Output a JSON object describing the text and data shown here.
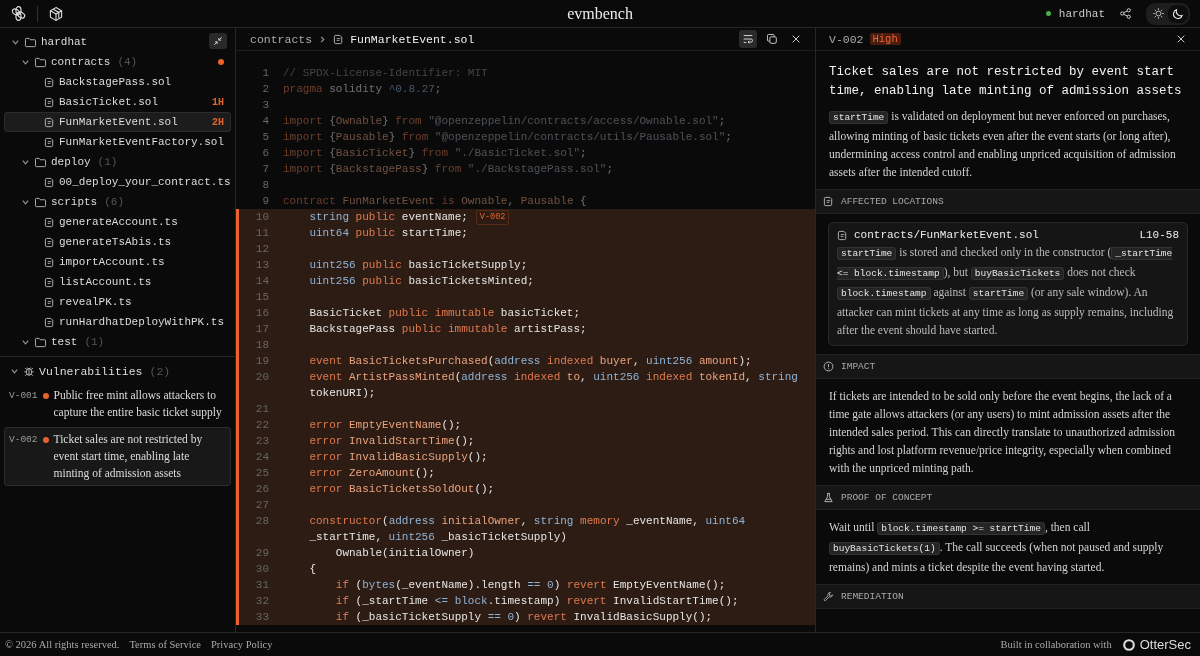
{
  "header": {
    "title": "evmbench",
    "project": "hardhat",
    "theme": [
      {
        "kind": "light",
        "selected": false
      },
      {
        "kind": "dark",
        "selected": true
      }
    ]
  },
  "explorer": {
    "tree": [
      {
        "name": "hardhat",
        "kind": "folder",
        "expanded": true,
        "selected": false,
        "flagged": false,
        "children": [
          {
            "name": "contracts",
            "count": "(4)",
            "kind": "folder",
            "expanded": true,
            "selected": false,
            "flagged": true,
            "children": [
              {
                "name": "BackstagePass.sol",
                "kind": "file",
                "selected": false,
                "flagged": false
              },
              {
                "name": "BasicTicket.sol",
                "kind": "file",
                "badge": "1H",
                "selected": false,
                "flagged": false
              },
              {
                "name": "FunMarketEvent.sol",
                "kind": "file",
                "badge": "2H",
                "selected": true,
                "flagged": false
              },
              {
                "name": "FunMarketEventFactory.sol",
                "kind": "file",
                "selected": false,
                "flagged": false
              }
            ]
          },
          {
            "name": "deploy",
            "count": "(1)",
            "kind": "folder",
            "expanded": true,
            "selected": false,
            "flagged": false,
            "children": [
              {
                "name": "00_deploy_your_contract.ts",
                "kind": "file",
                "selected": false,
                "flagged": false
              }
            ]
          },
          {
            "name": "scripts",
            "count": "(6)",
            "kind": "folder",
            "expanded": true,
            "selected": false,
            "flagged": false,
            "children": [
              {
                "name": "generateAccount.ts",
                "kind": "file",
                "selected": false,
                "flagged": false
              },
              {
                "name": "generateTsAbis.ts",
                "kind": "file",
                "selected": false,
                "flagged": false
              },
              {
                "name": "importAccount.ts",
                "kind": "file",
                "selected": false,
                "flagged": false
              },
              {
                "name": "listAccount.ts",
                "kind": "file",
                "selected": false,
                "flagged": false
              },
              {
                "name": "revealPK.ts",
                "kind": "file",
                "selected": false,
                "flagged": false
              },
              {
                "name": "runHardhatDeployWithPK.ts",
                "kind": "file",
                "selected": false,
                "flagged": false
              }
            ]
          },
          {
            "name": "test",
            "count": "(1)",
            "kind": "folder",
            "expanded": true,
            "selected": false,
            "flagged": false
          }
        ]
      }
    ]
  },
  "vulnerabilities": {
    "title": "Vulnerabilities",
    "count": "(2)",
    "expanded": true,
    "items": [
      {
        "id": "V-001",
        "text": "Public free mint allows attackers to capture the entire basic ticket supply",
        "selected": false
      },
      {
        "id": "V-002",
        "text": "Ticket sales are not restricted by event start time, enabling late minting of admission assets",
        "selected": true
      }
    ]
  },
  "editor": {
    "breadcrumb": [
      "contracts",
      "FunMarketEvent.sol"
    ],
    "wrap": true,
    "lines": [
      {
        "number": "1",
        "highlighted": false,
        "tokens": [
          {
            "kind": "comment",
            "text": "// SPDX-License-Identifier: MIT"
          }
        ]
      },
      {
        "number": "2",
        "highlighted": false,
        "tokens": [
          {
            "kind": "keyword",
            "text": "pragma"
          },
          {
            "kind": "plain",
            "text": " solidity "
          },
          {
            "kind": "type",
            "text": "^0.8.27"
          },
          {
            "kind": "plain",
            "text": ";"
          }
        ]
      },
      {
        "number": "3",
        "highlighted": false
      },
      {
        "number": "4",
        "highlighted": false,
        "tokens": [
          {
            "kind": "keyword",
            "text": "import"
          },
          {
            "kind": "plain",
            "text": " {"
          },
          {
            "kind": "name",
            "text": "Ownable"
          },
          {
            "kind": "plain",
            "text": "} "
          },
          {
            "kind": "keyword",
            "text": "from"
          },
          {
            "kind": "string",
            "text": " \"@openzeppelin/contracts/access/Ownable.sol\""
          },
          {
            "kind": "plain",
            "text": ";"
          }
        ]
      },
      {
        "number": "5",
        "highlighted": false,
        "tokens": [
          {
            "kind": "keyword",
            "text": "import"
          },
          {
            "kind": "plain",
            "text": " {"
          },
          {
            "kind": "name",
            "text": "Pausable"
          },
          {
            "kind": "plain",
            "text": "} "
          },
          {
            "kind": "keyword",
            "text": "from"
          },
          {
            "kind": "string",
            "text": " \"@openzeppelin/contracts/utils/Pausable.sol\""
          },
          {
            "kind": "plain",
            "text": ";"
          }
        ]
      },
      {
        "number": "6",
        "highlighted": false,
        "tokens": [
          {
            "kind": "keyword",
            "text": "import"
          },
          {
            "kind": "plain",
            "text": " {"
          },
          {
            "kind": "name",
            "text": "BasicTicket"
          },
          {
            "kind": "plain",
            "text": "} "
          },
          {
            "kind": "keyword",
            "text": "from"
          },
          {
            "kind": "string",
            "text": " \"./BasicTicket.sol\""
          },
          {
            "kind": "plain",
            "text": ";"
          }
        ]
      },
      {
        "number": "7",
        "highlighted": false,
        "tokens": [
          {
            "kind": "keyword",
            "text": "import"
          },
          {
            "kind": "plain",
            "text": " {"
          },
          {
            "kind": "name",
            "text": "BackstagePass"
          },
          {
            "kind": "plain",
            "text": "} "
          },
          {
            "kind": "keyword",
            "text": "from"
          },
          {
            "kind": "string",
            "text": " \"./BackstagePass.sol\""
          },
          {
            "kind": "plain",
            "text": ";"
          }
        ]
      },
      {
        "number": "8",
        "highlighted": false
      },
      {
        "number": "9",
        "highlighted": false,
        "tokens": [
          {
            "kind": "keyword",
            "text": "contract "
          },
          {
            "kind": "name",
            "text": "FunMarketEvent "
          },
          {
            "kind": "keyword",
            "text": "is "
          },
          {
            "kind": "name",
            "text": "Ownable"
          },
          {
            "kind": "plain",
            "text": ", "
          },
          {
            "kind": "name",
            "text": "Pausable"
          },
          {
            "kind": "plain",
            "text": " {"
          }
        ],
        "children": [
          {
            "number": "10",
            "highlighted": true,
            "badge": "V-002",
            "tokens": [
              {
                "kind": "type",
                "text": "string "
              },
              {
                "kind": "keyword",
                "text": "public "
              },
              {
                "kind": "plain",
                "text": "eventName;"
              }
            ]
          },
          {
            "number": "11",
            "highlighted": true,
            "tokens": [
              {
                "kind": "type",
                "text": "uint64 "
              },
              {
                "kind": "keyword",
                "text": "public "
              },
              {
                "kind": "plain",
                "text": "startTime;"
              }
            ]
          },
          {
            "number": "12",
            "highlighted": true
          },
          {
            "number": "13",
            "highlighted": true,
            "tokens": [
              {
                "kind": "type",
                "text": "uint256 "
              },
              {
                "kind": "keyword",
                "text": "public "
              },
              {
                "kind": "plain",
                "text": "basicTicketSupply;"
              }
            ]
          },
          {
            "number": "14",
            "highlighted": true,
            "tokens": [
              {
                "kind": "type",
                "text": "uint256 "
              },
              {
                "kind": "keyword",
                "text": "public "
              },
              {
                "kind": "plain",
                "text": "basicTicketsMinted;"
              }
            ]
          },
          {
            "number": "15",
            "highlighted": true
          },
          {
            "number": "16",
            "highlighted": true,
            "tokens": [
              {
                "kind": "plain",
                "text": "BasicTicket "
              },
              {
                "kind": "keyword",
                "text": "public immutable "
              },
              {
                "kind": "plain",
                "text": "basicTicket;"
              }
            ]
          },
          {
            "number": "17",
            "highlighted": true,
            "tokens": [
              {
                "kind": "plain",
                "text": "BackstagePass "
              },
              {
                "kind": "keyword",
                "text": "public immutable "
              },
              {
                "kind": "plain",
                "text": "artistPass;"
              }
            ]
          },
          {
            "number": "18",
            "highlighted": true
          },
          {
            "number": "19",
            "highlighted": true,
            "tokens": [
              {
                "kind": "keyword",
                "text": "event "
              },
              {
                "kind": "name",
                "text": "BasicTicketsPurchased"
              },
              {
                "kind": "plain",
                "text": "("
              },
              {
                "kind": "type",
                "text": "address "
              },
              {
                "kind": "keyword",
                "text": "indexed "
              },
              {
                "kind": "name",
                "text": "buyer"
              },
              {
                "kind": "plain",
                "text": ", "
              },
              {
                "kind": "type",
                "text": "uint256 "
              },
              {
                "kind": "name",
                "text": "amount"
              },
              {
                "kind": "plain",
                "text": ");"
              }
            ]
          },
          {
            "number": "20",
            "highlighted": true,
            "tokens": [
              {
                "kind": "keyword",
                "text": "event "
              },
              {
                "kind": "name",
                "text": "ArtistPassMinted"
              },
              {
                "kind": "plain",
                "text": "("
              },
              {
                "kind": "type",
                "text": "address "
              },
              {
                "kind": "keyword",
                "text": "indexed "
              },
              {
                "kind": "name",
                "text": "to"
              },
              {
                "kind": "plain",
                "text": ", "
              },
              {
                "kind": "type",
                "text": "uint256 "
              },
              {
                "kind": "keyword",
                "text": "indexed "
              },
              {
                "kind": "name",
                "text": "tokenId"
              },
              {
                "kind": "plain",
                "text": ", "
              },
              {
                "kind": "type",
                "text": "string "
              },
              {
                "kind": "plain",
                "text": "tokenURI);"
              }
            ]
          },
          {
            "number": "21",
            "highlighted": true
          },
          {
            "number": "22",
            "highlighted": true,
            "tokens": [
              {
                "kind": "keyword",
                "text": "error "
              },
              {
                "kind": "name",
                "text": "EmptyEventName"
              },
              {
                "kind": "plain",
                "text": "();"
              }
            ]
          },
          {
            "number": "23",
            "highlighted": true,
            "tokens": [
              {
                "kind": "keyword",
                "text": "error "
              },
              {
                "kind": "name",
                "text": "InvalidStartTime"
              },
              {
                "kind": "plain",
                "text": "();"
              }
            ]
          },
          {
            "number": "24",
            "highlighted": true,
            "tokens": [
              {
                "kind": "keyword",
                "text": "error "
              },
              {
                "kind": "name",
                "text": "InvalidBasicSupply"
              },
              {
                "kind": "plain",
                "text": "();"
              }
            ]
          },
          {
            "number": "25",
            "highlighted": true,
            "tokens": [
              {
                "kind": "keyword",
                "text": "error "
              },
              {
                "kind": "name",
                "text": "ZeroAmount"
              },
              {
                "kind": "plain",
                "text": "();"
              }
            ]
          },
          {
            "number": "26",
            "highlighted": true,
            "tokens": [
              {
                "kind": "keyword",
                "text": "error "
              },
              {
                "kind": "name",
                "text": "BasicTicketsSoldOut"
              },
              {
                "kind": "plain",
                "text": "();"
              }
            ]
          },
          {
            "number": "27",
            "highlighted": true
          },
          {
            "number": "28",
            "highlighted": true,
            "tokens": [
              {
                "kind": "keyword",
                "text": "constructor"
              },
              {
                "kind": "plain",
                "text": "("
              },
              {
                "kind": "type",
                "text": "address "
              },
              {
                "kind": "name",
                "text": "initialOwner"
              },
              {
                "kind": "plain",
                "text": ", "
              },
              {
                "kind": "type",
                "text": "string "
              },
              {
                "kind": "keyword",
                "text": "memory "
              },
              {
                "kind": "plain",
                "text": "_eventName, "
              },
              {
                "kind": "type",
                "text": "uint64 "
              },
              {
                "kind": "plain",
                "text": "_startTime, "
              },
              {
                "kind": "type",
                "text": "uint256 "
              },
              {
                "kind": "plain",
                "text": "_basicTicketSupply)"
              }
            ],
            "children": [
              {
                "number": "29",
                "highlighted": true,
                "tokens": [
                  {
                    "kind": "plain",
                    "text": "Ownable(initialOwner)"
                  }
                ]
              }
            ]
          },
          {
            "number": "30",
            "highlighted": true,
            "tokens": [
              {
                "kind": "plain",
                "text": "{"
              }
            ],
            "children": [
              {
                "number": "31",
                "highlighted": true,
                "tokens": [
                  {
                    "kind": "keyword",
                    "text": "if "
                  },
                  {
                    "kind": "plain",
                    "text": "("
                  },
                  {
                    "kind": "type",
                    "text": "bytes"
                  },
                  {
                    "kind": "plain",
                    "text": "(_eventName).length "
                  },
                  {
                    "kind": "type",
                    "text": "== 0"
                  },
                  {
                    "kind": "plain",
                    "text": ") "
                  },
                  {
                    "kind": "keyword",
                    "text": "revert "
                  },
                  {
                    "kind": "plain",
                    "text": "EmptyEventName();"
                  }
                ]
              },
              {
                "number": "32",
                "highlighted": true,
                "tokens": [
                  {
                    "kind": "keyword",
                    "text": "if "
                  },
                  {
                    "kind": "plain",
                    "text": "(_startTime "
                  },
                  {
                    "kind": "type",
                    "text": "<= block"
                  },
                  {
                    "kind": "plain",
                    "text": ".timestamp) "
                  },
                  {
                    "kind": "keyword",
                    "text": "revert "
                  },
                  {
                    "kind": "plain",
                    "text": "InvalidStartTime();"
                  }
                ]
              },
              {
                "number": "33",
                "highlighted": true,
                "tokens": [
                  {
                    "kind": "keyword",
                    "text": "if "
                  },
                  {
                    "kind": "plain",
                    "text": "(_basicTicketSupply "
                  },
                  {
                    "kind": "type",
                    "text": "== 0"
                  },
                  {
                    "kind": "plain",
                    "text": ") "
                  },
                  {
                    "kind": "keyword",
                    "text": "revert "
                  },
                  {
                    "kind": "plain",
                    "text": "InvalidBasicSupply();"
                  }
                ]
              }
            ]
          }
        ]
      }
    ]
  },
  "finding": {
    "id": "V-002",
    "severity": "High",
    "title": "Ticket sales are not restricted by event start time, enabling late minting of admission assets",
    "summary": [
      {
        "kind": "code",
        "text": "startTime"
      },
      {
        "kind": "text",
        "text": " is validated on deployment but never enforced on purchases, allowing minting of basic tickets even after the event starts (or long after), undermining access control and enabling unpriced acquisition of admission assets after the intended cutoff."
      }
    ],
    "sections": [
      {
        "kind": "locations",
        "heading": "AFFECTED LOCATIONS",
        "locations": [
          {
            "file": "contracts/FunMarketEvent.sol",
            "range": "L10-58",
            "note": [
              {
                "kind": "code",
                "text": "startTime"
              },
              {
                "kind": "text",
                "text": " is stored and checked only in the constructor ("
              },
              {
                "kind": "code",
                "text": "_startTime <= block.timestamp"
              },
              {
                "kind": "text",
                "text": "), but "
              },
              {
                "kind": "code",
                "text": "buyBasicTickets"
              },
              {
                "kind": "text",
                "text": " does not check "
              },
              {
                "kind": "code",
                "text": "block.timestamp"
              },
              {
                "kind": "text",
                "text": " against "
              },
              {
                "kind": "code",
                "text": "startTime"
              },
              {
                "kind": "text",
                "text": " (or any sale window). An attacker can mint tickets at any time as long as supply remains, including after the event should have started."
              }
            ]
          }
        ]
      },
      {
        "kind": "impact",
        "heading": "IMPACT",
        "body": [
          {
            "kind": "text",
            "text": "If tickets are intended to be sold only before the event begins, the lack of a time gate allows attackers (or any users) to mint admission assets after the intended sales period. This can directly translate to unauthorized admission rights and lost platform revenue/price integrity, especially when combined with the unpriced minting path."
          }
        ]
      },
      {
        "kind": "poc",
        "heading": "PROOF OF CONCEPT",
        "body": [
          {
            "kind": "text",
            "text": "Wait until "
          },
          {
            "kind": "code",
            "text": "block.timestamp >= startTime"
          },
          {
            "kind": "text",
            "text": ", then call "
          },
          {
            "kind": "code",
            "text": "buyBasicTickets(1)"
          },
          {
            "kind": "text",
            "text": ". The call succeeds (when not paused and supply remains) and mints a ticket despite the event having started."
          }
        ]
      },
      {
        "kind": "remediation",
        "heading": "REMEDIATION"
      }
    ]
  },
  "footer": {
    "copyright": "© 2026 All rights reserved.",
    "links": [
      "Terms of Service",
      "Privacy Policy"
    ],
    "credit": "Built in collaboration with",
    "partner": "OtterSec"
  }
}
